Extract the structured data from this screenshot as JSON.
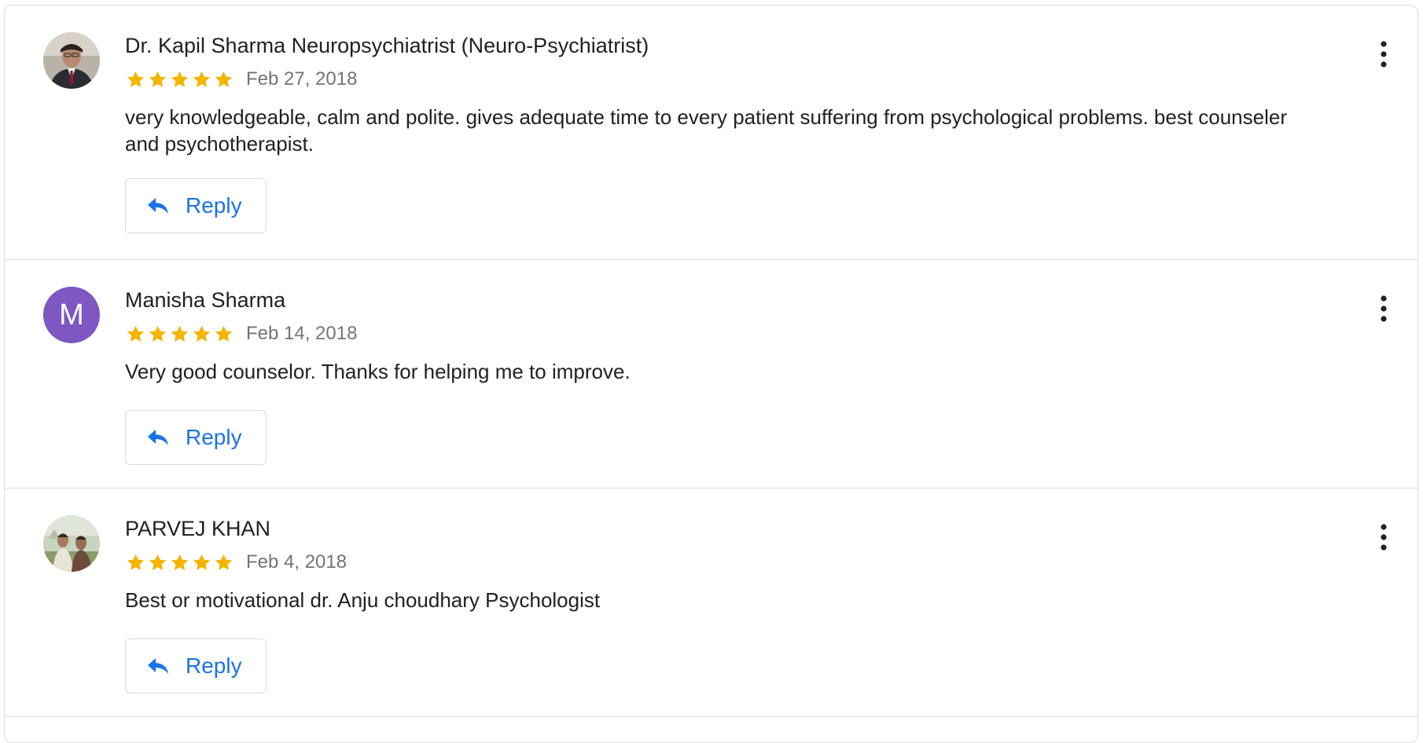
{
  "reviews": [
    {
      "author": "Dr. Kapil Sharma Neuropsychiatrist (Neuro-Psychiatrist)",
      "rating": 5,
      "date": "Feb 27, 2018",
      "text": "very knowledgeable, calm and polite. gives adequate time to every patient suffering from psychological problems. best counseler and psychotherapist.",
      "avatar": "photo",
      "reply_label": "Reply"
    },
    {
      "author": "Manisha Sharma",
      "rating": 5,
      "date": "Feb 14, 2018",
      "text": "Very good counselor. Thanks for helping me to improve.",
      "avatar": "letter",
      "avatar_letter": "M",
      "reply_label": "Reply"
    },
    {
      "author": "PARVEJ KHAN",
      "rating": 5,
      "date": "Feb 4, 2018",
      "text": "Best or motivational dr. Anju choudhary Psychologist",
      "avatar": "photo",
      "reply_label": "Reply"
    }
  ],
  "colors": {
    "star": "#f4b400",
    "link": "#1a73e8",
    "avatar_letter_bg": "#7e57c2",
    "divider": "#dadce0"
  },
  "icons": {
    "star": "star-icon",
    "reply": "reply-arrow-icon",
    "more": "more-vert-icon"
  }
}
